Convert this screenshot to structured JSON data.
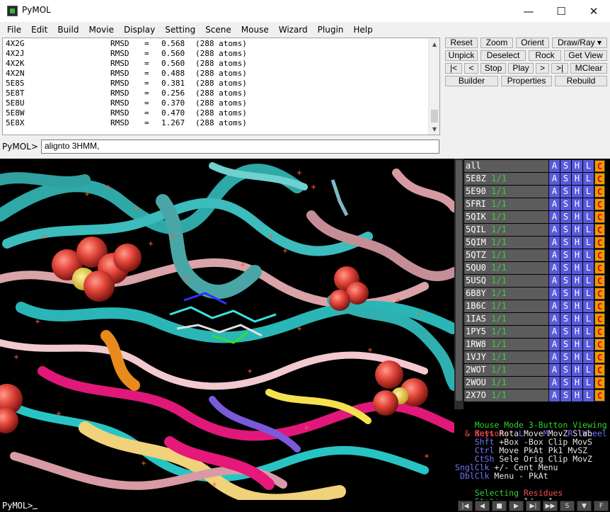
{
  "window": {
    "title": "PyMOL",
    "minimize": "—",
    "maximize": "☐",
    "close": "✕"
  },
  "menu": [
    "File",
    "Edit",
    "Build",
    "Movie",
    "Display",
    "Setting",
    "Scene",
    "Mouse",
    "Wizard",
    "Plugin",
    "Help"
  ],
  "output": {
    "lines": [
      {
        "id": "4X2G",
        "rmsd": "0.568",
        "atoms": "(288 atoms)"
      },
      {
        "id": "4X2J",
        "rmsd": "0.560",
        "atoms": "(288 atoms)"
      },
      {
        "id": "4X2K",
        "rmsd": "0.560",
        "atoms": "(288 atoms)"
      },
      {
        "id": "4X2N",
        "rmsd": "0.488",
        "atoms": "(288 atoms)"
      },
      {
        "id": "5E8S",
        "rmsd": "0.381",
        "atoms": "(288 atoms)"
      },
      {
        "id": "5E8T",
        "rmsd": "0.256",
        "atoms": "(288 atoms)"
      },
      {
        "id": "5E8U",
        "rmsd": "0.370",
        "atoms": "(288 atoms)"
      },
      {
        "id": "5E8W",
        "rmsd": "0.470",
        "atoms": "(288 atoms)"
      },
      {
        "id": "5E8X",
        "rmsd": "1.267",
        "atoms": "(288 atoms)"
      }
    ],
    "rmsd_label": "RMSD",
    "equals": "="
  },
  "command": {
    "prompt": "PyMOL>",
    "value": "alignto 3HMM,"
  },
  "buttons": {
    "row1": [
      "Reset",
      "Zoom",
      "Orient",
      "Draw/Ray ▾"
    ],
    "row2": [
      "Unpick",
      "Deselect",
      "Rock",
      "Get View"
    ],
    "row3": [
      "|<",
      "<",
      "Stop",
      "Play",
      ">",
      ">|",
      "MClear"
    ],
    "row4": [
      "Builder",
      "Properties",
      "Rebuild"
    ]
  },
  "objects": {
    "state_label": "1/1",
    "button_labels": [
      "A",
      "S",
      "H",
      "L",
      "C"
    ],
    "items": [
      "all",
      "5E8Z",
      "5E90",
      "5FRI",
      "5QIK",
      "5QIL",
      "5QIM",
      "5QTZ",
      "5QU0",
      "5USQ",
      "6B8Y",
      "1B6C",
      "1IAS",
      "1PY5",
      "1RW8",
      "1VJY",
      "2WOT",
      "2WOU",
      "2X7O"
    ]
  },
  "mouse_mode": {
    "title_left": "Mouse Mode",
    "title_right": "3-Button Viewing",
    "buttons_label": "Buttons",
    "col_l": "L",
    "col_m": "M",
    "col_r": "R",
    "col_wheel": "Wheel",
    "rows": [
      {
        "key": "& Keys",
        "l": "Rota",
        "m": "Move",
        "r": "MovZ",
        "w": "Slab"
      },
      {
        "key": "Shft",
        "l": "+Box",
        "m": "-Box",
        "r": "Clip",
        "w": "MovS"
      },
      {
        "key": "Ctrl",
        "l": "Move",
        "m": "PkAt",
        "r": "Pk1",
        "w": "MvSZ"
      },
      {
        "key": "CtSh",
        "l": "Sele",
        "m": "Orig",
        "r": "Clip",
        "w": "MovZ"
      },
      {
        "key": "SnglClk",
        "l": "+/-",
        "m": "Cent",
        "r": "Menu",
        "w": ""
      },
      {
        "key": "DblClk",
        "l": "Menu",
        "m": "-",
        "r": "PkAt",
        "w": ""
      }
    ],
    "selecting_label": "Selecting",
    "selecting_value": "Residues",
    "state_label": "State",
    "state_value": "1/",
    "state_total": "1"
  },
  "bottom": {
    "prompt": "PyMOL>",
    "vcr": [
      "|◀",
      "◀",
      "■",
      "▶",
      "▶|",
      "▶▶",
      "S",
      "▼",
      "F"
    ]
  },
  "colors": {
    "viewport_bg": "#000000",
    "object_name_bg": "#5c5c5c",
    "object_btn_bg": "#5a5adc",
    "color_btn_bg": "#f49700",
    "state_green": "#3fcf3f"
  }
}
